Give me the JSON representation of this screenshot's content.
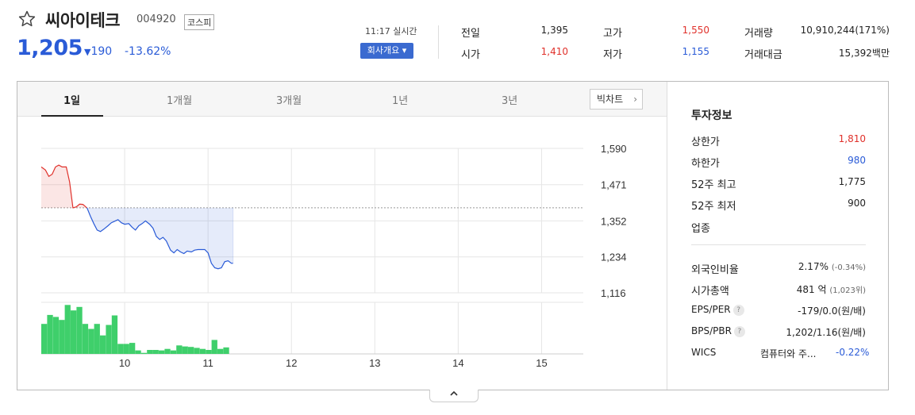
{
  "stock": {
    "name": "씨아이테크",
    "code": "004920",
    "market": "코스피",
    "price": "1,205",
    "change": "190",
    "change_rate": "-13.62%",
    "realtime": "11:17 실시간",
    "company_button": "회사개요 ▾"
  },
  "summary": [
    {
      "label": "전일",
      "value": "1,395",
      "color": "#222222"
    },
    {
      "label": "고가",
      "value": "1,550",
      "color": "#e0312b"
    },
    {
      "label": "거래량",
      "value": "10,910,244(171%)",
      "color": "#222222"
    },
    {
      "label": "시가",
      "value": "1,410",
      "color": "#e0312b"
    },
    {
      "label": "저가",
      "value": "1,155",
      "color": "#2a5bd7"
    },
    {
      "label": "거래대금",
      "value": "15,392백만",
      "color": "#222222"
    }
  ],
  "tabs": [
    "1일",
    "1개월",
    "3개월",
    "1년",
    "3년"
  ],
  "big_chart_button": "빅차트",
  "chart_data": {
    "type": "area",
    "y_ticks": [
      "1,590",
      "1,471",
      "1,352",
      "1,234",
      "1,116"
    ],
    "ylim": [
      1116,
      1590
    ],
    "x_ticks": [
      "10",
      "11",
      "12",
      "13",
      "14",
      "15"
    ],
    "xlim": [
      9.0,
      15.5
    ],
    "base_price": 1395,
    "colors": {
      "up": "#e0312b",
      "down": "#2a5bd7",
      "volume": "#3fcf6b"
    },
    "price_series": [
      {
        "t": 9.0,
        "p": 1529
      },
      {
        "t": 9.05,
        "p": 1519
      },
      {
        "t": 9.09,
        "p": 1498
      },
      {
        "t": 9.13,
        "p": 1505
      },
      {
        "t": 9.17,
        "p": 1529
      },
      {
        "t": 9.21,
        "p": 1535
      },
      {
        "t": 9.25,
        "p": 1529
      },
      {
        "t": 9.3,
        "p": 1529
      },
      {
        "t": 9.34,
        "p": 1480
      },
      {
        "t": 9.38,
        "p": 1395
      },
      {
        "t": 9.42,
        "p": 1398
      },
      {
        "t": 9.46,
        "p": 1407
      },
      {
        "t": 9.5,
        "p": 1406
      },
      {
        "t": 9.55,
        "p": 1394
      },
      {
        "t": 9.59,
        "p": 1367
      },
      {
        "t": 9.63,
        "p": 1343
      },
      {
        "t": 9.67,
        "p": 1322
      },
      {
        "t": 9.71,
        "p": 1317
      },
      {
        "t": 9.75,
        "p": 1325
      },
      {
        "t": 9.8,
        "p": 1336
      },
      {
        "t": 9.84,
        "p": 1346
      },
      {
        "t": 9.88,
        "p": 1351
      },
      {
        "t": 9.92,
        "p": 1356
      },
      {
        "t": 9.96,
        "p": 1346
      },
      {
        "t": 10.0,
        "p": 1341
      },
      {
        "t": 10.05,
        "p": 1343
      },
      {
        "t": 10.09,
        "p": 1331
      },
      {
        "t": 10.13,
        "p": 1322
      },
      {
        "t": 10.17,
        "p": 1336
      },
      {
        "t": 10.21,
        "p": 1343
      },
      {
        "t": 10.25,
        "p": 1352
      },
      {
        "t": 10.3,
        "p": 1341
      },
      {
        "t": 10.34,
        "p": 1328
      },
      {
        "t": 10.38,
        "p": 1301
      },
      {
        "t": 10.42,
        "p": 1291
      },
      {
        "t": 10.46,
        "p": 1298
      },
      {
        "t": 10.5,
        "p": 1286
      },
      {
        "t": 10.55,
        "p": 1256
      },
      {
        "t": 10.59,
        "p": 1247
      },
      {
        "t": 10.63,
        "p": 1258
      },
      {
        "t": 10.67,
        "p": 1250
      },
      {
        "t": 10.71,
        "p": 1245
      },
      {
        "t": 10.75,
        "p": 1253
      },
      {
        "t": 10.8,
        "p": 1250
      },
      {
        "t": 10.84,
        "p": 1256
      },
      {
        "t": 10.88,
        "p": 1258
      },
      {
        "t": 10.92,
        "p": 1258
      },
      {
        "t": 10.96,
        "p": 1258
      },
      {
        "t": 11.0,
        "p": 1247
      },
      {
        "t": 11.04,
        "p": 1213
      },
      {
        "t": 11.08,
        "p": 1198
      },
      {
        "t": 11.12,
        "p": 1195
      },
      {
        "t": 11.16,
        "p": 1198
      },
      {
        "t": 11.2,
        "p": 1218
      },
      {
        "t": 11.24,
        "p": 1221
      },
      {
        "t": 11.28,
        "p": 1213
      },
      {
        "t": 11.3,
        "p": 1213
      }
    ],
    "volume_series": [
      60,
      78,
      74,
      68,
      98,
      87,
      94,
      60,
      50,
      60,
      37,
      58,
      77,
      20,
      20,
      22,
      7,
      2,
      8,
      8,
      7,
      10,
      7,
      17,
      15,
      14,
      12,
      10,
      8,
      28,
      10,
      13
    ]
  },
  "invest": {
    "title": "투자정보",
    "rows": [
      {
        "label": "상한가",
        "value": "1,810",
        "color": "#e0312b"
      },
      {
        "label": "하한가",
        "value": "980",
        "color": "#2a5bd7"
      },
      {
        "label": "52주 최고",
        "value": "1,775",
        "color": "#222222"
      },
      {
        "label": "52주 최저",
        "value": "900",
        "color": "#222222"
      },
      {
        "label": "업종",
        "value": "",
        "color": "#222222"
      }
    ],
    "rows2": [
      {
        "label": "외국인비율",
        "value": "2.17%",
        "sub": "(-0.34%)",
        "help": false
      },
      {
        "label": "시가총액",
        "value": "481 억",
        "sub": "(1,023위)",
        "help": false
      },
      {
        "label": "EPS/PER",
        "value": "-179/0.0",
        "sub": "(원/배)",
        "help": true
      },
      {
        "label": "BPS/PBR",
        "value": "1,202/1.16",
        "sub": "(원/배)",
        "help": true
      }
    ],
    "wics": {
      "label": "WICS",
      "value": "컴퓨터와 주...",
      "change": "-0.22%"
    }
  },
  "collapse_icon": "chevron-up-icon"
}
